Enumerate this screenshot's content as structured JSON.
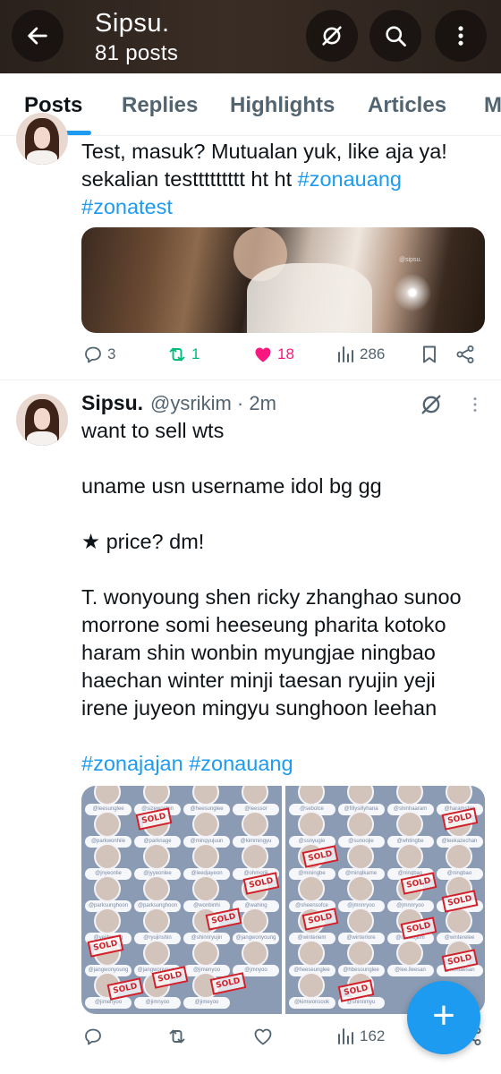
{
  "header": {
    "name": "Sipsu.",
    "post_count": "81 posts",
    "icons": [
      "arrow-left-icon",
      "notification-off-icon",
      "search-icon",
      "more-vertical-icon"
    ]
  },
  "tabs": [
    {
      "label": "Posts",
      "active": true
    },
    {
      "label": "Replies",
      "active": false
    },
    {
      "label": "Highlights",
      "active": false
    },
    {
      "label": "Articles",
      "active": false
    },
    {
      "label": "M",
      "active": false
    }
  ],
  "tweet1": {
    "text_line1": "Test, masuk? Mutualan yuk, like aja ya!",
    "text_line2_plain": "sekalian testtttttttt ht ht ",
    "text_line2_tag": "#zonauang",
    "text_line3_tag": "#zonatest",
    "media_watermark": "@sipsu.",
    "actions": {
      "replies": "3",
      "reposts": "1",
      "likes": "18",
      "views": "286"
    }
  },
  "tweet2": {
    "name": "Sipsu.",
    "handle_time": "@ysrikim · 2m",
    "line1": "want to sell wts",
    "line2": "uname usn username idol bg gg",
    "line3": "★ price? dm!",
    "line4": "T. wonyoung shen ricky zhanghao sunoo",
    "line5": "morrone somi heeseung pharita kotoko",
    "line6": "haram shin wonbin myungjae ningbao",
    "line7": "haechan winter minji taesan ryujin yeji",
    "line8": "irene juyeon mingyu sunghoon leehan",
    "tag1": "#zonajajan",
    "tag2": "#zonauang",
    "sheet_left_labels": [
      "@leesunglee",
      "@sizewonbin",
      "@heesunglee",
      "@leessor",
      "@parkwonhile",
      "@parknage",
      "@mingyujuun",
      "@kimmingyu",
      "@jnyeonlie",
      "@jyyeonlee",
      "@leedjayeon",
      "@ohmoriji",
      "@parksunghoon",
      "@parksunghoon",
      "@wonbinhi",
      "@wahing",
      "@yejihwang",
      "@ryujinshin",
      "@shinnryujin",
      "@jangwonyoung",
      "@jangwonyoung",
      "@jangwonyoung",
      "@jimenyoo",
      "@jmnyoo",
      "@jimenyoo",
      "@jimnyoo",
      "@jimeyoo"
    ],
    "sheet_right_labels": [
      "@sebolce",
      "@fillysillyhana",
      "@shinhaaram",
      "@haramshin",
      "@ssnyugie",
      "@sunoojie",
      "@whtingbe",
      "@leekazechan",
      "@miningbe",
      "@minglkame",
      "@ningbao",
      "@ningbao",
      "@sheensofce",
      "@jmnnryoo",
      "@jmnnryoo",
      "@jihryoo",
      "@winteriem",
      "@winterlore",
      "@minsojilim",
      "@winterelee",
      "@heeseunglee",
      "@hbesounglee",
      "@lee.lleesan",
      "@hentaesan",
      "@kimwonsook",
      "@shinnmyu"
    ],
    "sold_label": "SOLD",
    "actions": {
      "views": "162"
    }
  },
  "fab": {
    "label": "+"
  }
}
